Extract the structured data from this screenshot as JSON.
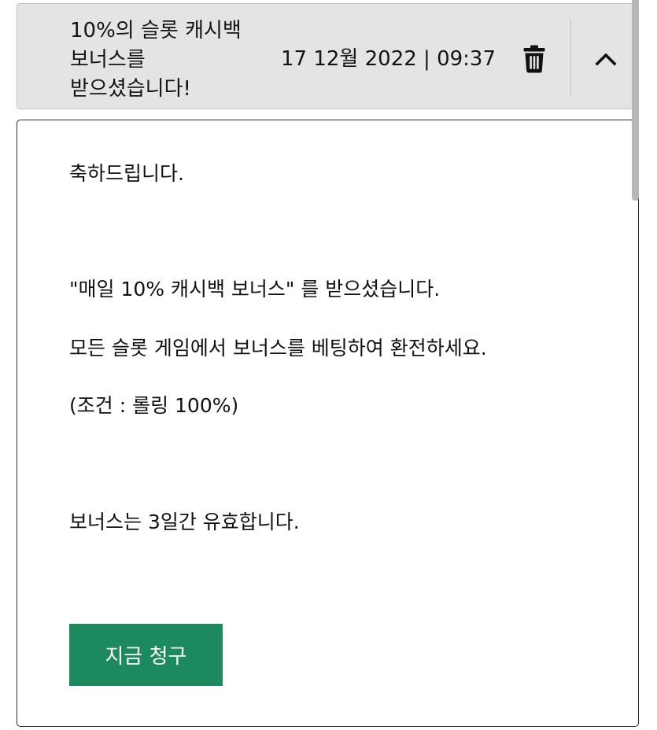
{
  "message": {
    "title": "10%의 슬롯 캐시백 보너스를 받으셨습니다!",
    "date": "17 12월 2022 | 09:37",
    "delete_icon": "trash-icon",
    "collapse_icon": "chevron-up-icon",
    "body": {
      "greeting": "축하드립니다.",
      "received": "\"매일 10% 캐시백 보너스\" 를 받으셨습니다.",
      "instruction": "모든 슬롯 게임에서 보너스를 베팅하여 환전하세요.",
      "condition": "(조건 : 롤링 100%)",
      "validity": "보너스는 3일간 유효합니다."
    },
    "claim_button_label": "지금 청구"
  },
  "colors": {
    "header_bg": "#e4e4e4",
    "button_green": "#1c8a5e",
    "scrollbar": "#b7b7b7"
  }
}
